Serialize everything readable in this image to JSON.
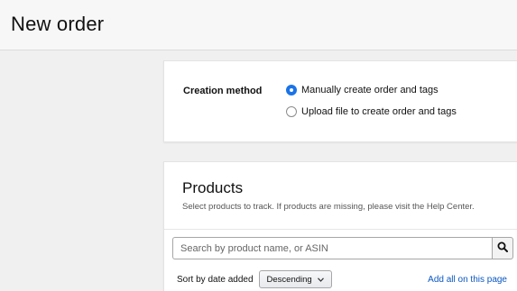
{
  "header": {
    "title": "New order"
  },
  "creation": {
    "label": "Creation method",
    "options": [
      {
        "label": "Manually create order and tags",
        "checked": true
      },
      {
        "label": "Upload file to create order and tags",
        "checked": false
      }
    ]
  },
  "products": {
    "title": "Products",
    "subtitle": "Select products to track. If products are missing, please visit the Help Center.",
    "search": {
      "placeholder": "Search by product name, or ASIN",
      "value": "",
      "icon": "search-icon"
    },
    "sort": {
      "label": "Sort by date added",
      "selected": "Descending",
      "icon": "chevron-down-icon"
    },
    "add_all_label": "Add all on this page"
  },
  "colors": {
    "accent": "#1a73e8",
    "link": "#0a57c2",
    "background": "#f0f0f0"
  }
}
